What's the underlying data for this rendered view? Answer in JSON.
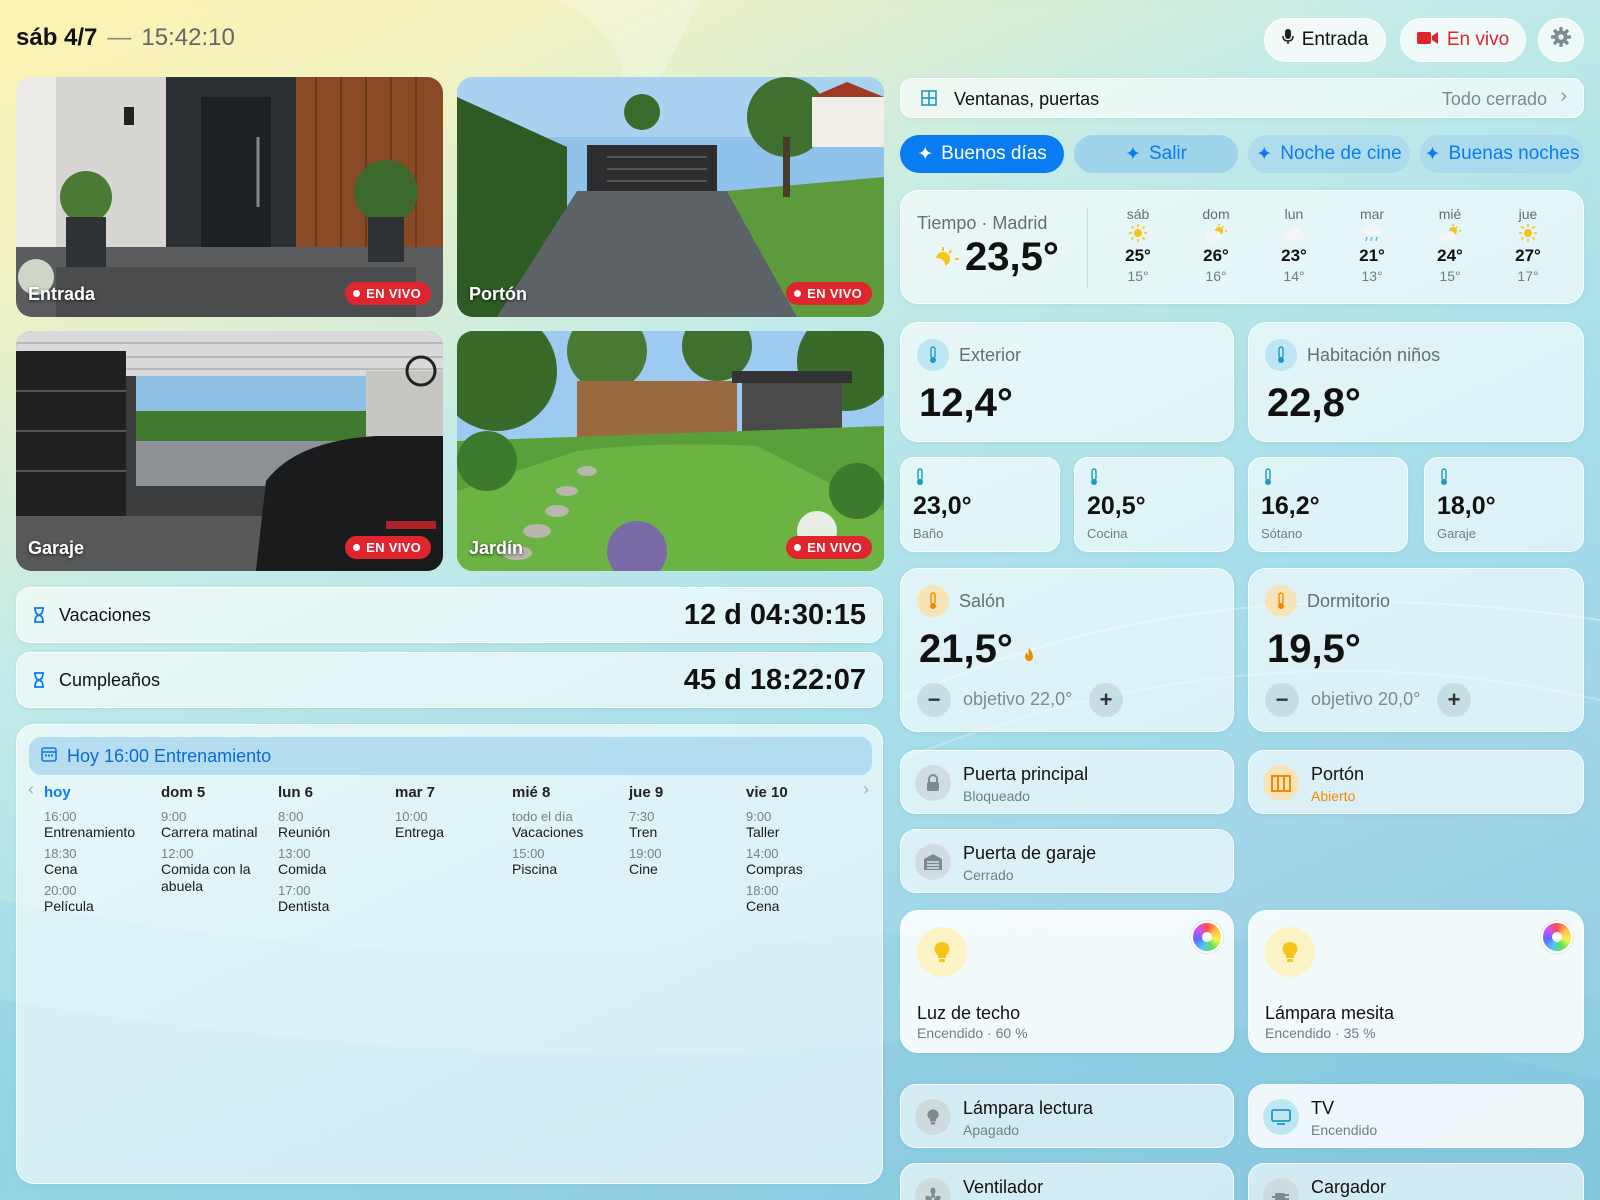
{
  "header": {
    "date": "sáb 4/7",
    "separator": "—",
    "time": "15:42:10",
    "btn_entrada": "Entrada",
    "btn_en_vivo": "En vivo"
  },
  "cameras": [
    {
      "label": "Entrada",
      "live": "EN VIVO"
    },
    {
      "label": "Portón",
      "live": "EN VIVO"
    },
    {
      "label": "Garaje",
      "live": "EN VIVO"
    },
    {
      "label": "Jardín",
      "live": "EN VIVO"
    }
  ],
  "countdowns": [
    {
      "label": "Vacaciones",
      "value": "12 d 04:30:15"
    },
    {
      "label": "Cumpleaños",
      "value": "45 d 18:22:07"
    }
  ],
  "calendar": {
    "banner": "Hoy 16:00 Entrenamiento",
    "days": [
      {
        "name": "hoy",
        "events": [
          {
            "time": "16:00",
            "title": "Entrenamiento"
          },
          {
            "time": "18:30",
            "title": "Cena"
          },
          {
            "time": "20:00",
            "title": "Película"
          }
        ]
      },
      {
        "name": "dom 5",
        "events": [
          {
            "time": "9:00",
            "title": "Carrera matinal"
          },
          {
            "time": "12:00",
            "title": "Comida con la abuela"
          }
        ]
      },
      {
        "name": "lun 6",
        "events": [
          {
            "time": "8:00",
            "title": "Reunión"
          },
          {
            "time": "13:00",
            "title": "Comida"
          },
          {
            "time": "17:00",
            "title": "Dentista"
          }
        ]
      },
      {
        "name": "mar 7",
        "events": [
          {
            "time": "10:00",
            "title": "Entrega"
          }
        ]
      },
      {
        "name": "mié 8",
        "events": [
          {
            "time": "todo el día",
            "title": "Vacaciones"
          },
          {
            "time": "15:00",
            "title": "Piscina"
          }
        ]
      },
      {
        "name": "jue 9",
        "events": [
          {
            "time": "7:30",
            "title": "Tren"
          },
          {
            "time": "19:00",
            "title": "Cine"
          }
        ]
      },
      {
        "name": "vie 10",
        "events": [
          {
            "time": "9:00",
            "title": "Taller"
          },
          {
            "time": "14:00",
            "title": "Compras"
          },
          {
            "time": "18:00",
            "title": "Cena"
          }
        ]
      }
    ]
  },
  "openings": {
    "label": "Ventanas, puertas",
    "status": "Todo cerrado"
  },
  "scenes": [
    "Buenos días",
    "Salir",
    "Noche de cine",
    "Buenas noches"
  ],
  "weather": {
    "title": "Tiempo · Madrid",
    "current": "23,5°",
    "current_icon": "partly-sunny-icon",
    "forecast": [
      {
        "day": "sáb",
        "icon": "sun-icon",
        "high": "25°",
        "low": "15°"
      },
      {
        "day": "dom",
        "icon": "partly-sunny-icon",
        "high": "26°",
        "low": "16°"
      },
      {
        "day": "lun",
        "icon": "cloud-icon",
        "high": "23°",
        "low": "14°"
      },
      {
        "day": "mar",
        "icon": "rain-icon",
        "high": "21°",
        "low": "13°"
      },
      {
        "day": "mié",
        "icon": "partly-sunny-icon",
        "high": "24°",
        "low": "15°"
      },
      {
        "day": "jue",
        "icon": "sun-icon",
        "high": "27°",
        "low": "17°"
      }
    ]
  },
  "temps_large": [
    {
      "label": "Exterior",
      "value": "12,4°"
    },
    {
      "label": "Habitación niños",
      "value": "22,8°"
    }
  ],
  "temps_small": [
    {
      "label": "Baño",
      "value": "23,0°"
    },
    {
      "label": "Cocina",
      "value": "20,5°"
    },
    {
      "label": "Sótano",
      "value": "16,2°"
    },
    {
      "label": "Garaje",
      "value": "18,0°"
    }
  ],
  "thermostats": [
    {
      "label": "Salón",
      "value": "21,5°",
      "target": "objetivo 22,0°",
      "heating": true
    },
    {
      "label": "Dormitorio",
      "value": "19,5°",
      "target": "objetivo 20,0°",
      "heating": false
    }
  ],
  "locks": [
    {
      "title": "Puerta principal",
      "status": "Bloqueado"
    },
    {
      "title": "Portón",
      "status": "Abierto"
    },
    {
      "title": "Puerta de garaje",
      "status": "Cerrado"
    }
  ],
  "lights": [
    {
      "title": "Luz de techo",
      "status": "Encendido · 60 %"
    },
    {
      "title": "Lámpara mesita",
      "status": "Encendido · 35 %"
    }
  ],
  "devices": [
    {
      "title": "Lámpara lectura",
      "status": "Apagado"
    },
    {
      "title": "TV",
      "status": "Encendido"
    },
    {
      "title": "Ventilador",
      "status": ""
    },
    {
      "title": "Cargador",
      "status": ""
    }
  ],
  "colors": {
    "accent": "#0a7cf2",
    "live_red": "#e0252e",
    "open_orange": "#f08a00",
    "heat_orange": "#f08a00",
    "sun_yellow": "#f7c21a"
  }
}
